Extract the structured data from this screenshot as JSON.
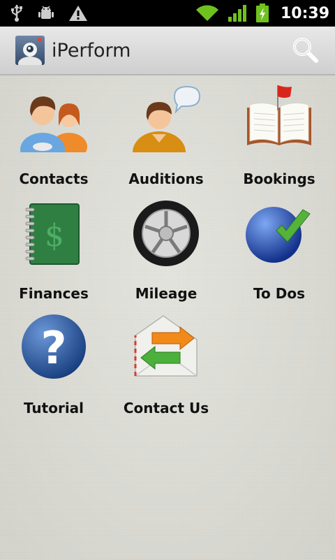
{
  "status_bar": {
    "time": "10:39"
  },
  "action_bar": {
    "title": "iPerform"
  },
  "grid": [
    {
      "label": "Contacts",
      "icon": "contacts-icon"
    },
    {
      "label": "Auditions",
      "icon": "auditions-icon"
    },
    {
      "label": "Bookings",
      "icon": "bookings-icon"
    },
    {
      "label": "Finances",
      "icon": "finances-icon"
    },
    {
      "label": "Mileage",
      "icon": "mileage-icon"
    },
    {
      "label": "To Dos",
      "icon": "todos-icon"
    },
    {
      "label": "Tutorial",
      "icon": "tutorial-icon"
    },
    {
      "label": "Contact Us",
      "icon": "contact-us-icon"
    }
  ]
}
